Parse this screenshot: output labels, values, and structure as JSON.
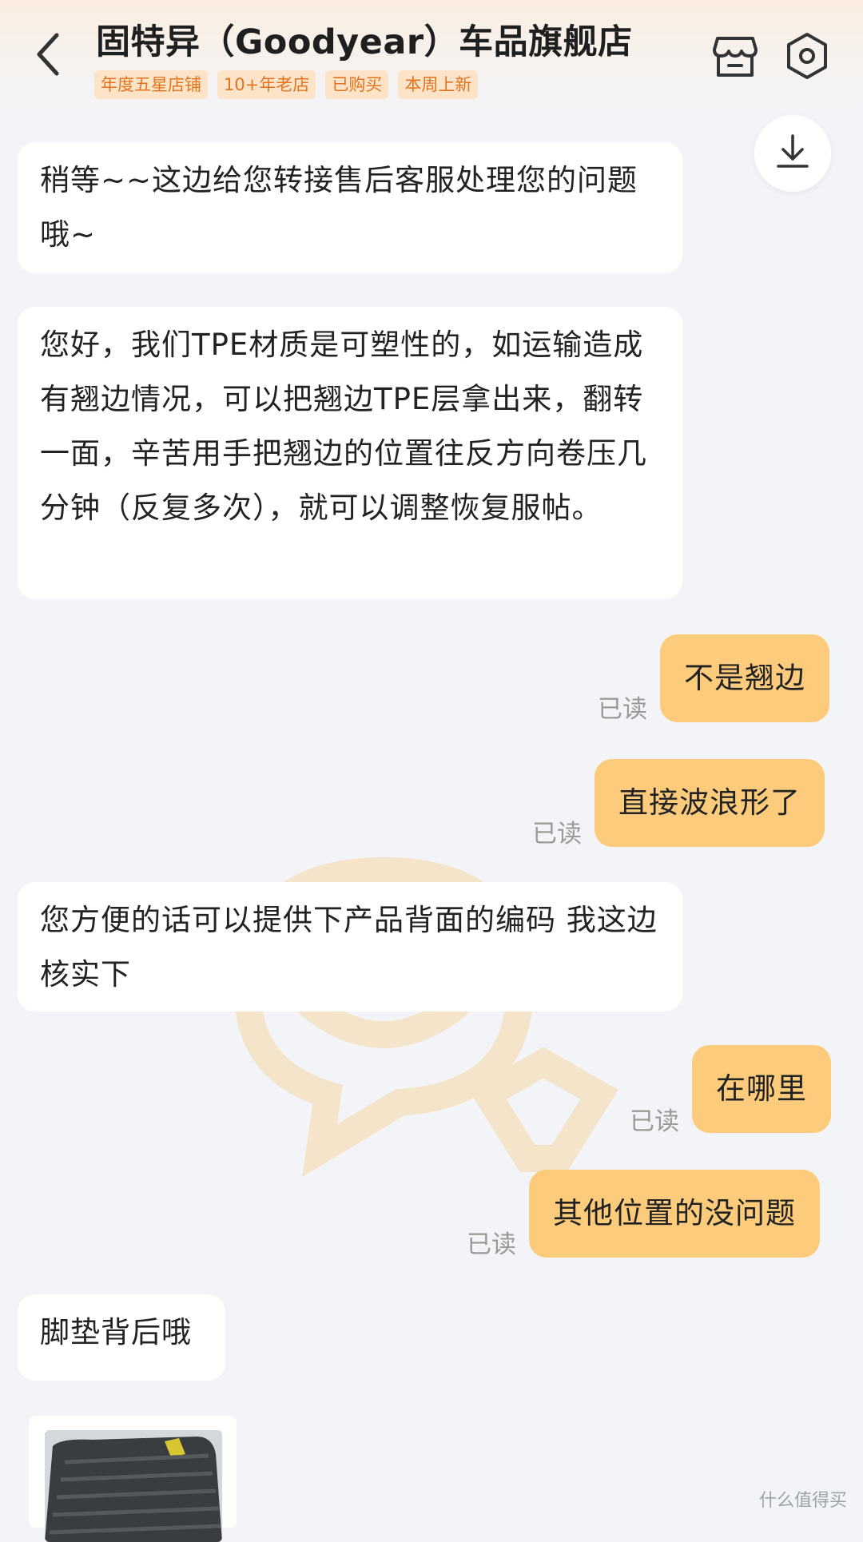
{
  "header": {
    "shop_title": "固特异（Goodyear）车品旗舰店",
    "badges": [
      "年度五星店铺",
      "10+年老店",
      "已购买",
      "本周上新"
    ],
    "back_icon": "chevron-left-icon",
    "store_icon": "store-icon",
    "settings_icon": "gear-icon",
    "download_icon": "download-icon"
  },
  "colors": {
    "background": "#f3f4f8",
    "outgoing_bubble": "#fccc7c",
    "incoming_bubble": "#ffffff",
    "badge_bg": "#fde3c7",
    "badge_text": "#e2741f",
    "read_text": "#9a9a9a"
  },
  "messages": {
    "m1": "稍等~~这边给您转接售后客服处理您的问题哦~",
    "m2": " 您好，我们TPE材质是可塑性的，如运输造成有翘边情况，可以把翘边TPE层拿出来，翻转一面，辛苦用手把翘边的位置往反方向卷压几分钟（反复多次），就可以调整恢复服帖。",
    "m3": "不是翘边",
    "m4": "直接波浪形了",
    "m5": "您方便的话可以提供下产品背面的编码 我这边核实下",
    "m6": "在哪里",
    "m7": "其他位置的没问题",
    "m8": "脚垫背后哦"
  },
  "read_label": "已读",
  "site_watermark": "什么值得买"
}
